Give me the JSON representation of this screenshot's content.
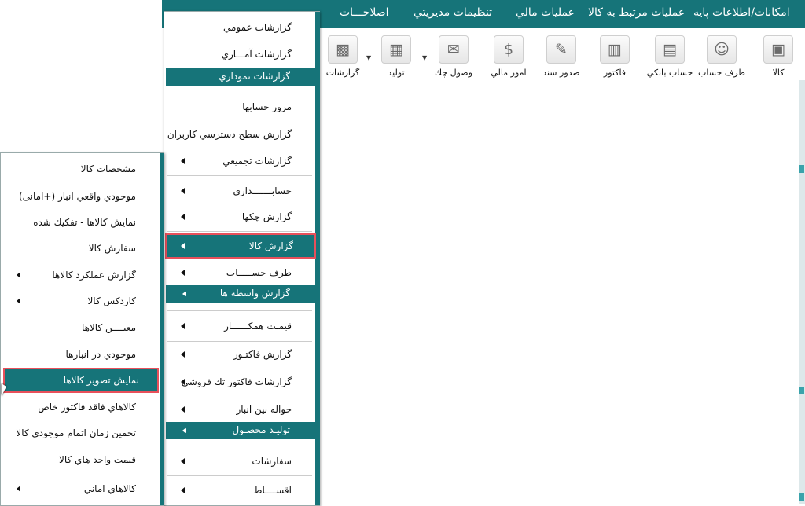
{
  "menubar": [
    "امکانات/اطلاعات پایه",
    "عملیات مرتبط به کالا",
    "عملیات مالي",
    "تنظیمات مدیریتي",
    "اصلاحـــات"
  ],
  "toolbar": [
    {
      "label": "کالا",
      "icon": "box-icon",
      "glyph": "▣"
    },
    {
      "label": "طرف حساب",
      "icon": "person-icon",
      "glyph": "☺"
    },
    {
      "label": "حساب بانکي",
      "icon": "card-icon",
      "glyph": "▤"
    },
    {
      "label": "فاکتور",
      "icon": "invoice-icon",
      "glyph": "▥"
    },
    {
      "label": "صدور سند",
      "icon": "document-pen-icon",
      "glyph": "✎"
    },
    {
      "label": "امور مالي",
      "icon": "finance-icon",
      "glyph": "$"
    },
    {
      "label": "وصول چك",
      "icon": "envelope-icon",
      "glyph": "✉"
    },
    {
      "label": "تولید",
      "icon": "factory-icon",
      "glyph": "▦"
    },
    {
      "label": "گزارشات",
      "icon": "report-chart-icon",
      "glyph": "▩"
    }
  ],
  "menu1": {
    "top_items": [
      "گزارشات عمومي",
      "گزارشات آمـــاري"
    ],
    "group_charts": "گزارشات نموداري",
    "items_a": [
      {
        "label": "مرور حسابها",
        "arrow": false
      },
      {
        "label": "گزارش سطح دسترسي کاربران",
        "arrow": false
      },
      {
        "label": "گزارشات تجمیعي",
        "arrow": true
      }
    ],
    "items_b": [
      {
        "label": "حسابـــــــداري",
        "arrow": true
      },
      {
        "label": "گزارش چکها",
        "arrow": true
      },
      {
        "label": "گزارش کالا",
        "arrow": true,
        "highlight": true
      },
      {
        "label": "طرف حســـــاب",
        "arrow": true
      }
    ],
    "group_brokers": "گزارش واسطه ها",
    "items_c": [
      {
        "label": "قیمـت همکــــــار",
        "arrow": true
      },
      {
        "label": "گزارش فاکتـور",
        "arrow": true
      },
      {
        "label": "گزارشات فاکتور تك فروشي",
        "arrow": true
      },
      {
        "label": "حواله بین انبار",
        "arrow": true
      }
    ],
    "group_production": "تولیـد محصـول",
    "items_d": [
      {
        "label": "سفارشات",
        "arrow": true
      },
      {
        "label": "اقســــاط",
        "arrow": true
      }
    ]
  },
  "menu2": {
    "items": [
      {
        "label": "مشخصات کالا",
        "arrow": false
      },
      {
        "label": "موجودي واقعي انبار (+امانی)",
        "arrow": false
      },
      {
        "label": "نمایش کالاها - تفکیك شده",
        "arrow": false
      },
      {
        "label": "سفارش کالا",
        "arrow": false
      },
      {
        "label": "گزارش عملکرد کالاها",
        "arrow": true
      },
      {
        "label": "کاردکس کالا",
        "arrow": true
      },
      {
        "label": "معیــــن کالاها",
        "arrow": false
      },
      {
        "label": "موجودي در انبارها",
        "arrow": false
      },
      {
        "label": "نمایش تصویر کالاها",
        "arrow": false,
        "highlight": true
      },
      {
        "label": "کالاهاي فاقد فاکتور خاص",
        "arrow": false
      },
      {
        "label": "تخمین زمان اتمام موجودي کالا",
        "arrow": false
      },
      {
        "label": "قیمت واحد هاي کالا",
        "arrow": false
      }
    ],
    "last_item": {
      "label": "کالاهاي اماني",
      "arrow": true
    }
  },
  "colors": {
    "teal": "#167479",
    "highlight_border": "#e8505b"
  }
}
